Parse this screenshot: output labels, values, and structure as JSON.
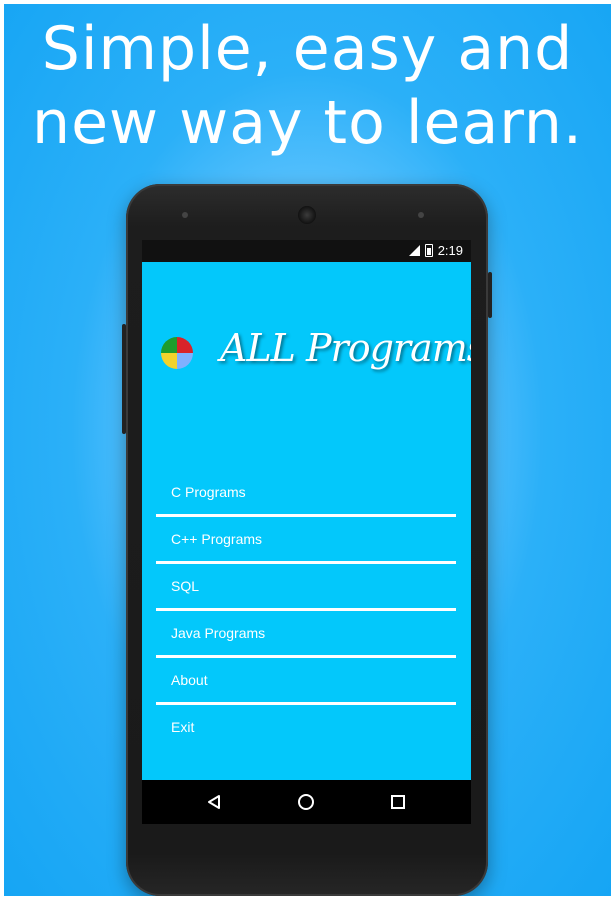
{
  "headline": {
    "line1": "Simple, easy and",
    "line2": "new way to learn."
  },
  "status_bar": {
    "time": "2:19",
    "icons": [
      "signal-icon",
      "battery-icon"
    ]
  },
  "app": {
    "title": "ALL Programs",
    "logo_colors": [
      "#1e9c2c",
      "#d8232a",
      "#7fb0ff",
      "#f2d32c"
    ]
  },
  "menu": {
    "items": [
      {
        "label": "C Programs"
      },
      {
        "label": "C++ Programs"
      },
      {
        "label": "SQL"
      },
      {
        "label": "Java Programs"
      },
      {
        "label": "About"
      },
      {
        "label": "Exit"
      }
    ]
  },
  "nav_bar": {
    "buttons": [
      "back-icon",
      "home-icon",
      "recents-icon"
    ]
  },
  "colors": {
    "background": "#16a5f4",
    "screen": "#03c8fb",
    "text": "#ffffff"
  }
}
